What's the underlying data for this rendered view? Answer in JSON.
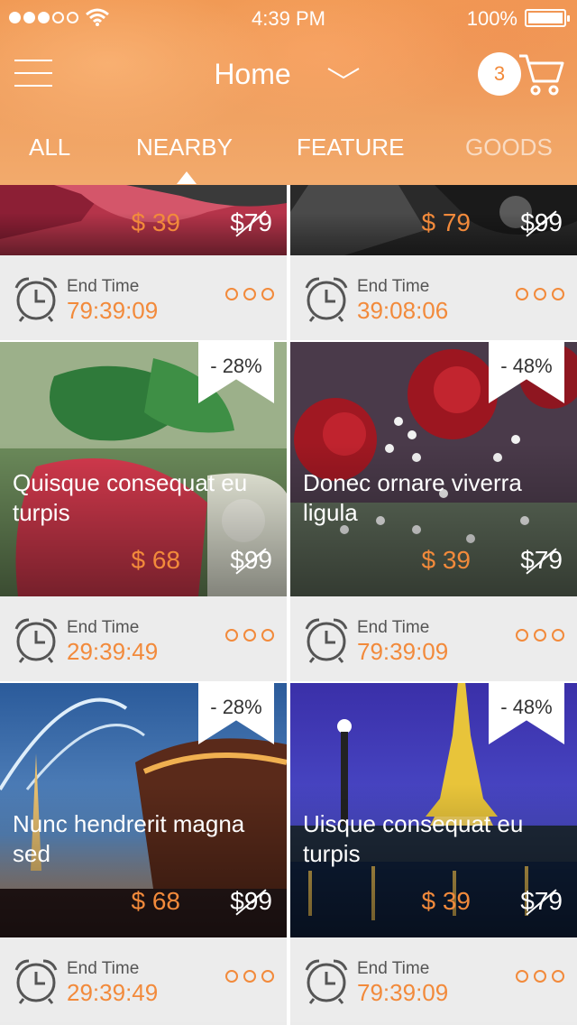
{
  "status_bar": {
    "time": "4:39 PM",
    "battery": "100%",
    "battery_level": 1.0,
    "signal_bars_filled": 3,
    "signal_bars_total": 5
  },
  "header": {
    "title": "Home",
    "cart_count": "3"
  },
  "tabs": [
    {
      "label": "ALL",
      "active": false
    },
    {
      "label": "NEARBY",
      "active": true
    },
    {
      "label": "FEATURE",
      "active": false
    },
    {
      "label": "GOODS",
      "active": false
    }
  ],
  "colors": {
    "accent": "#f28a3b",
    "header": "#f19a55"
  },
  "footer_label": "End Time",
  "cards": [
    {
      "title": "",
      "price": "$ 39",
      "old_price": "$79",
      "discount": "",
      "end_time": "79:39:09",
      "image": "fabric"
    },
    {
      "title": "",
      "price": "$ 79",
      "old_price": "$99",
      "discount": "",
      "end_time": "39:08:06",
      "image": "dark"
    },
    {
      "title": "Quisque consequat eu turpis",
      "price": "$ 68",
      "old_price": "$99",
      "discount": "- 28%",
      "end_time": "29:39:49",
      "image": "food"
    },
    {
      "title": "Donec ornare viverra ligula",
      "price": "$ 39",
      "old_price": "$79",
      "discount": "- 48%",
      "end_time": "79:39:09",
      "image": "roses"
    },
    {
      "title": "Nunc hendrerit magna sed",
      "price": "$ 68",
      "old_price": "$99",
      "discount": "- 28%",
      "end_time": "29:39:49",
      "image": "fountain"
    },
    {
      "title": "Uisque consequat eu turpis",
      "price": "$ 39",
      "old_price": "$79",
      "discount": "- 48%",
      "end_time": "79:39:09",
      "image": "eiffel"
    }
  ]
}
